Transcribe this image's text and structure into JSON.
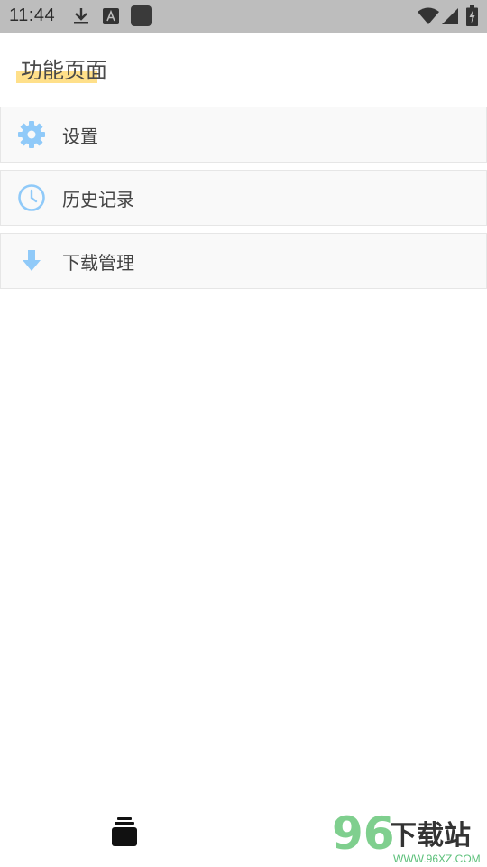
{
  "status_bar": {
    "time": "11:44",
    "icons": [
      "download-icon",
      "a-text-icon",
      "app-square-icon",
      "wifi-icon",
      "signal-icon",
      "battery-charging-icon"
    ]
  },
  "page": {
    "title": "功能页面",
    "highlight_color": "#ffe08a"
  },
  "menu": {
    "items": [
      {
        "icon": "gear-icon",
        "label": "设置"
      },
      {
        "icon": "clock-icon",
        "label": "历史记录"
      },
      {
        "icon": "arrow-down-icon",
        "label": "下载管理"
      }
    ],
    "icon_color": "#90caf9"
  },
  "bottom": {
    "icon": "stack-icon"
  },
  "watermark": {
    "digits": "96",
    "title": "下载站",
    "url": "WWW.96XZ.COM"
  }
}
